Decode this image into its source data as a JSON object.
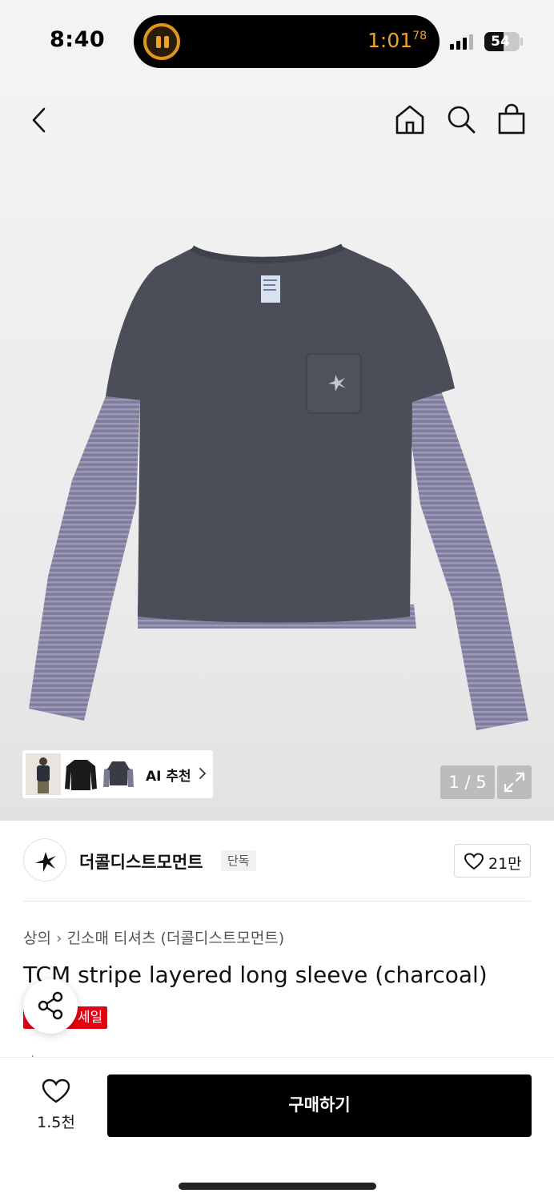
{
  "status_bar": {
    "time": "8:40",
    "timer": "1:01",
    "timer_fraction": "78",
    "battery": "54",
    "battery_level": 0.54
  },
  "hero": {
    "nav": {
      "back_icon": "chevron-left-icon",
      "home_icon": "home-icon",
      "search_icon": "search-icon",
      "cart_icon": "shopping-bag-icon"
    },
    "ai_recommend_label": "AI 추천",
    "page_counter": "1 / 5"
  },
  "brand": {
    "name": "더콜디스트모먼트",
    "badge": "단독",
    "likes": "21만"
  },
  "product": {
    "breadcrumb": [
      "상의",
      "긴소매 티셔츠 (더콜디스트모먼트)"
    ],
    "title": "TCM stripe layered long sleeve (charcoal)",
    "sale_badge": "세일"
  },
  "bottom_bar": {
    "wish_count": "1.5천",
    "buy_label": "구매하기"
  },
  "colors": {
    "accent_sale": "#e60012",
    "timer_orange": "#f0a12a",
    "buy_button": "#000000",
    "shirt_body": "#4b4d59",
    "sleeve_stripe": "#8a88a8"
  }
}
